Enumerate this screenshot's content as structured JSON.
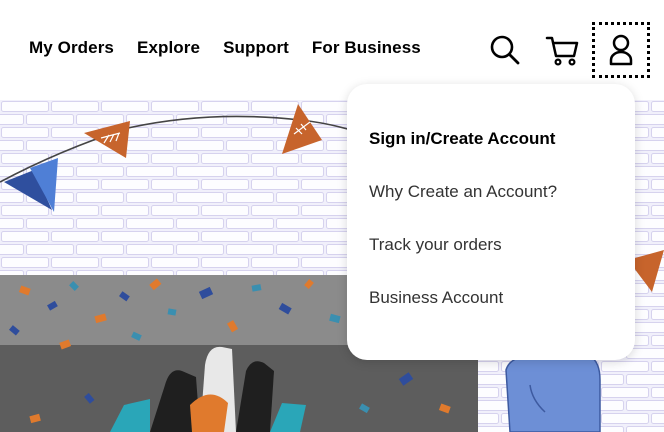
{
  "nav": {
    "links": [
      "My Orders",
      "Explore",
      "Support",
      "For Business"
    ],
    "icons": [
      "search-icon",
      "cart-icon",
      "user-icon"
    ]
  },
  "account_menu": {
    "items": [
      "Sign in/Create Account",
      "Why Create an Account?",
      "Track your orders",
      "Business Account"
    ]
  },
  "colors": {
    "pennant_orange": "#c7642c",
    "pennant_blue": "#3c64c0",
    "brick_background": "#f1f0fb",
    "brick_line": "#d6d2ee",
    "foam_finger": "#6d8fd6"
  }
}
